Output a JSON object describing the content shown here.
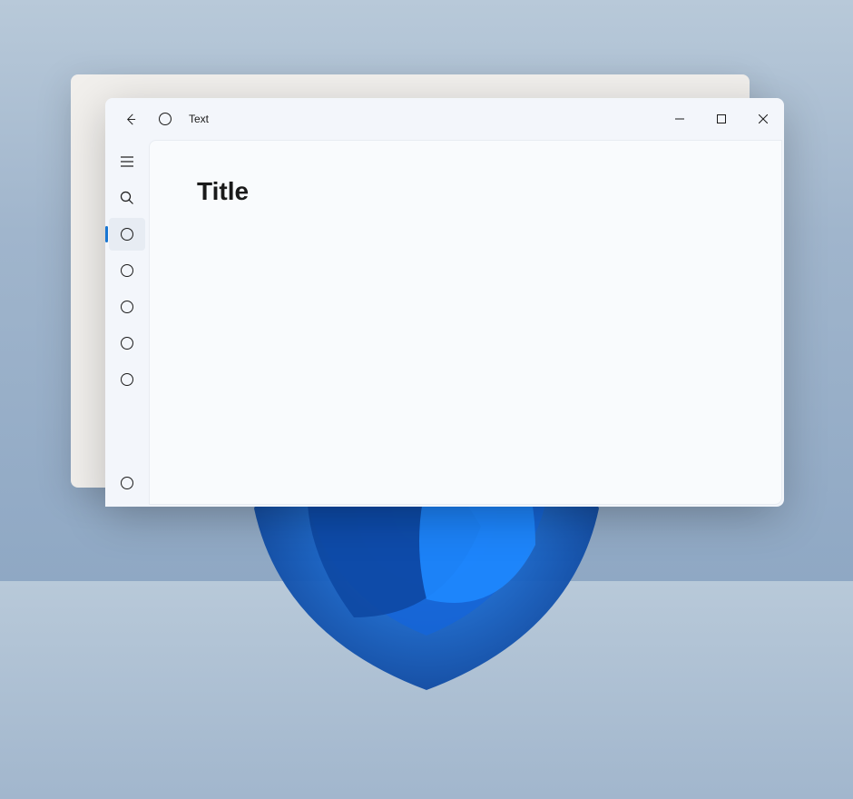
{
  "titlebar": {
    "app_title": "Text"
  },
  "content": {
    "title": "Title"
  }
}
